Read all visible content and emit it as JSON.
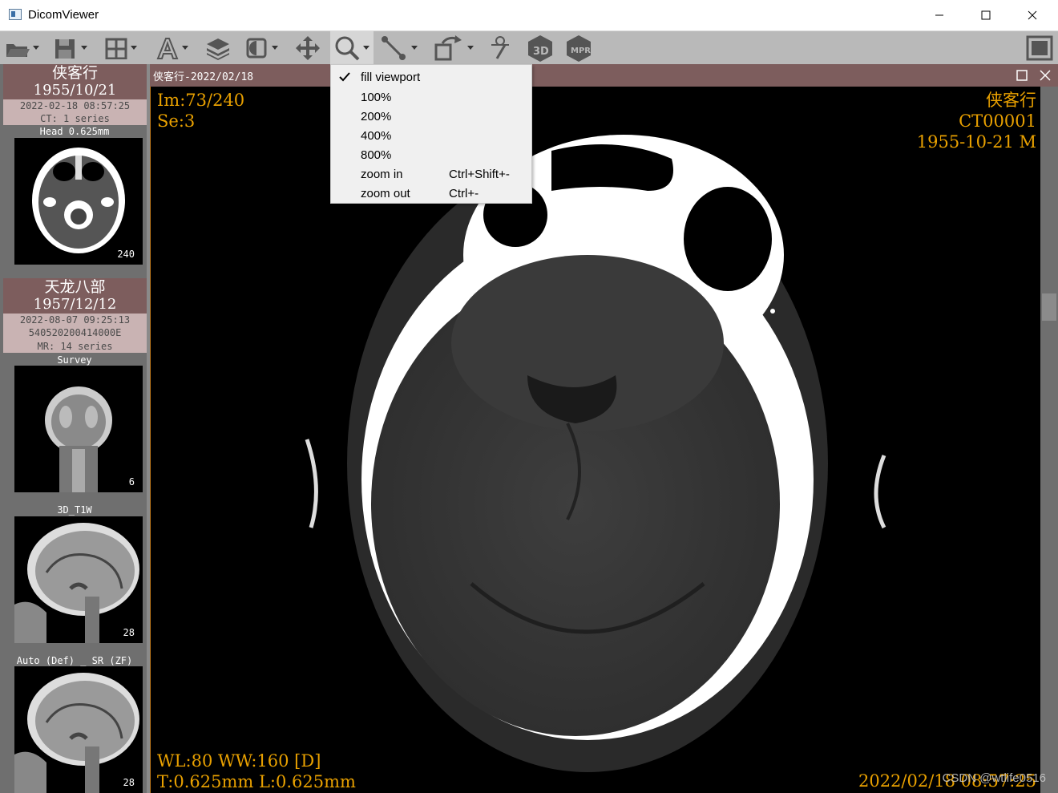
{
  "window": {
    "title": "DicomViewer"
  },
  "toolbar": {
    "buttons": [
      {
        "name": "open-folder-icon",
        "has_caret": true
      },
      {
        "name": "save-icon",
        "has_caret": true
      },
      {
        "name": "layout-grid-icon",
        "has_caret": true
      },
      {
        "name": "annotation-text-icon",
        "has_caret": true
      },
      {
        "name": "layers-icon",
        "has_caret": false
      },
      {
        "name": "window-level-icon",
        "has_caret": true
      },
      {
        "name": "pan-move-icon",
        "has_caret": false
      },
      {
        "name": "zoom-magnifier-icon",
        "has_caret": true,
        "active": true
      },
      {
        "name": "measure-line-icon",
        "has_caret": true
      },
      {
        "name": "rotate-flip-icon",
        "has_caret": true
      },
      {
        "name": "slice-tool-icon",
        "has_caret": false
      },
      {
        "name": "3d-cube-icon",
        "has_caret": false
      },
      {
        "name": "mpr-cube-icon",
        "has_caret": false
      },
      {
        "name": "fullscreen-icon",
        "has_caret": false
      }
    ]
  },
  "patients": [
    {
      "name": "侠客行",
      "dob": "1955/10/21",
      "study_datetime": "2022-02-18 08:57:25",
      "modality_line": "CT: 1 series",
      "series": [
        {
          "label": "Head 0.625mm",
          "count": "240"
        }
      ]
    },
    {
      "name": "天龙八部",
      "dob": "1957/12/12",
      "study_datetime": "2022-08-07 09:25:13",
      "accession": "540520200414000E",
      "modality_line": "MR: 14 series",
      "series": [
        {
          "label": "Survey",
          "count": "6"
        },
        {
          "label": "3D_T1W",
          "count": "28"
        },
        {
          "label": "Auto (Def) _ SR (ZF)",
          "count": "28"
        }
      ]
    }
  ],
  "viewport": {
    "tab_title": "侠客行-2022/02/18",
    "overlay": {
      "image_index": "Im:73/240",
      "series_index": "Se:3",
      "patient_name": "侠客行",
      "patient_id": "CT00001",
      "patient_dob_sex": "1955-10-21 M",
      "window": "WL:80 WW:160 [D]",
      "thickness_location": "T:0.625mm L:0.625mm",
      "study_datetime": "2022/02/18 08:57:25"
    },
    "watermark": "CSDN @wtlife0516"
  },
  "zoom_menu": {
    "items": [
      {
        "label": "fill viewport",
        "shortcut": "",
        "checked": true
      },
      {
        "label": "100%",
        "shortcut": "",
        "checked": false
      },
      {
        "label": "200%",
        "shortcut": "",
        "checked": false
      },
      {
        "label": "400%",
        "shortcut": "",
        "checked": false
      },
      {
        "label": "800%",
        "shortcut": "",
        "checked": false
      },
      {
        "label": "zoom in",
        "shortcut": "Ctrl+Shift+-",
        "checked": false
      },
      {
        "label": "zoom out",
        "shortcut": "Ctrl+-",
        "checked": false
      }
    ]
  },
  "colors": {
    "toolbar_bg": "#b9b9b9",
    "panel_bg": "#6f6f6f",
    "header_bg": "#7d5d5d",
    "overlay_text": "#e8a000"
  }
}
